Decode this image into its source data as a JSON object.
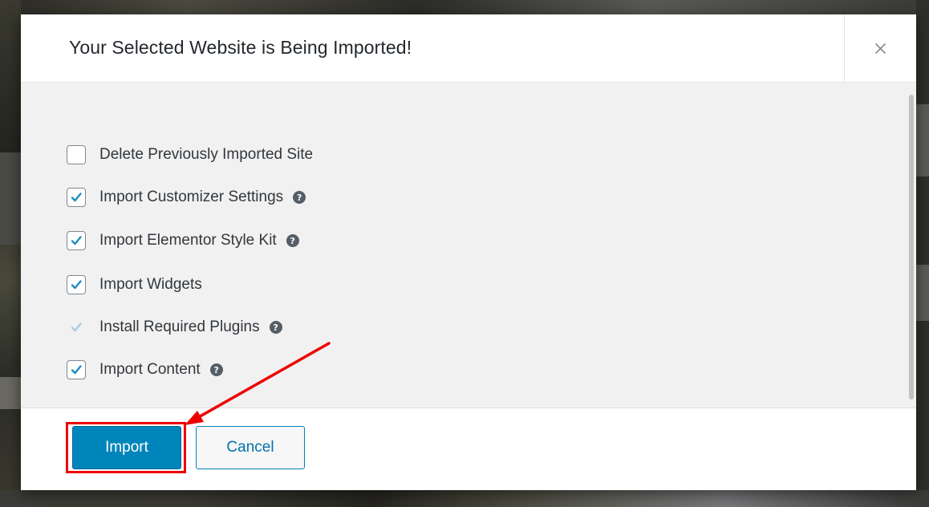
{
  "modal": {
    "title": "Your Selected Website is Being Imported!",
    "close_icon": "close-icon",
    "options": [
      {
        "label": "Delete Previously Imported Site",
        "checked": false,
        "help": false,
        "disabled": false
      },
      {
        "label": "Import Customizer Settings",
        "checked": true,
        "help": true,
        "disabled": false
      },
      {
        "label": "Import Elementor Style Kit",
        "checked": true,
        "help": true,
        "disabled": false
      },
      {
        "label": "Import Widgets",
        "checked": true,
        "help": false,
        "disabled": false
      },
      {
        "label": "Install Required Plugins",
        "checked": true,
        "help": true,
        "disabled": true
      },
      {
        "label": "Import Content",
        "checked": true,
        "help": true,
        "disabled": false
      }
    ],
    "help_icon": "question-circle-icon",
    "help_glyph": "?",
    "import_label": "Import",
    "cancel_label": "Cancel"
  },
  "colors": {
    "primary": "#0085ba",
    "check": "#1e8cbe",
    "check_disabled": "#a6cfe6",
    "annotation": "#ee0000"
  }
}
